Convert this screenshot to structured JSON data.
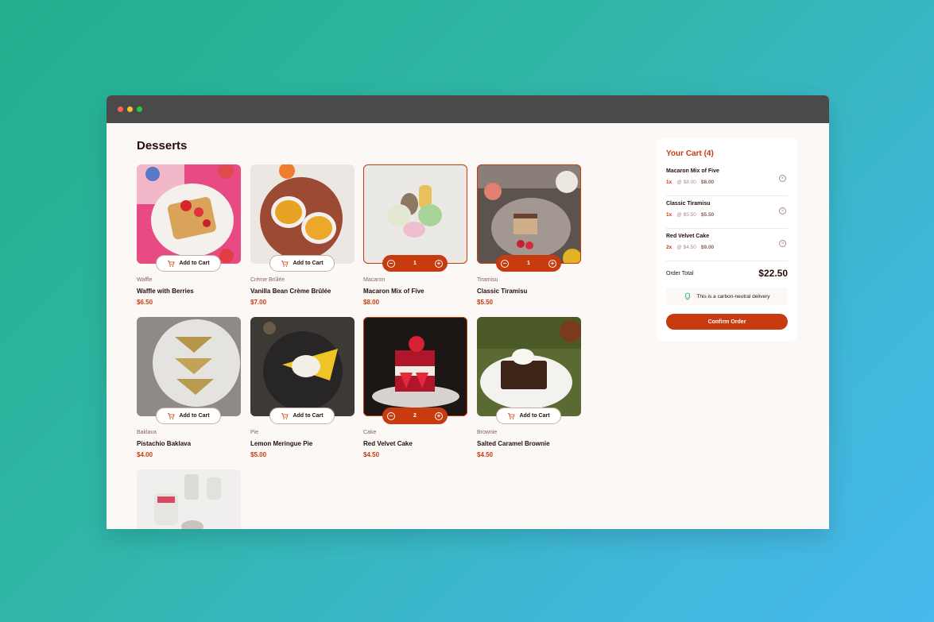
{
  "page_title": "Desserts",
  "products": [
    {
      "category": "Waffle",
      "name": "Waffle with Berries",
      "price": "$6.50",
      "button": "Add to Cart"
    },
    {
      "category": "Crème Brûlée",
      "name": "Vanilla Bean Crème Brûlée",
      "price": "$7.00",
      "button": "Add to Cart"
    },
    {
      "category": "Macaron",
      "name": "Macaron Mix of Five",
      "price": "$8.00",
      "quantity": "1"
    },
    {
      "category": "Tiramisu",
      "name": "Classic Tiramisu",
      "price": "$5.50",
      "quantity": "1"
    },
    {
      "category": "Baklava",
      "name": "Pistachio Baklava",
      "price": "$4.00",
      "button": "Add to Cart"
    },
    {
      "category": "Pie",
      "name": "Lemon Meringue Pie",
      "price": "$5.00",
      "button": "Add to Cart"
    },
    {
      "category": "Cake",
      "name": "Red Velvet Cake",
      "price": "$4.50",
      "quantity": "2"
    },
    {
      "category": "Brownie",
      "name": "Salted Caramel Brownie",
      "price": "$4.50",
      "button": "Add to Cart"
    }
  ],
  "cart": {
    "title": "Your Cart (4)",
    "items": [
      {
        "name": "Macaron Mix of Five",
        "qty": "1x",
        "unit": "@ $8.00",
        "total": "$8.00"
      },
      {
        "name": "Classic Tiramisu",
        "qty": "1x",
        "unit": "@ $5.50",
        "total": "$5.50"
      },
      {
        "name": "Red Velvet Cake",
        "qty": "2x",
        "unit": "@ $4.50",
        "total": "$9.00"
      }
    ],
    "order_total_label": "Order Total",
    "order_total_value": "$22.50",
    "carbon_note": "This is a carbon-neutral delivery",
    "confirm_label": "Confirm Order"
  },
  "colors": {
    "accent": "#c73b0f",
    "text": "#260f08",
    "muted": "#87635a",
    "background": "#fcf8f6"
  },
  "icons": [
    "add-to-cart-icon",
    "decrement-icon",
    "increment-icon",
    "remove-item-icon",
    "tree-icon"
  ]
}
